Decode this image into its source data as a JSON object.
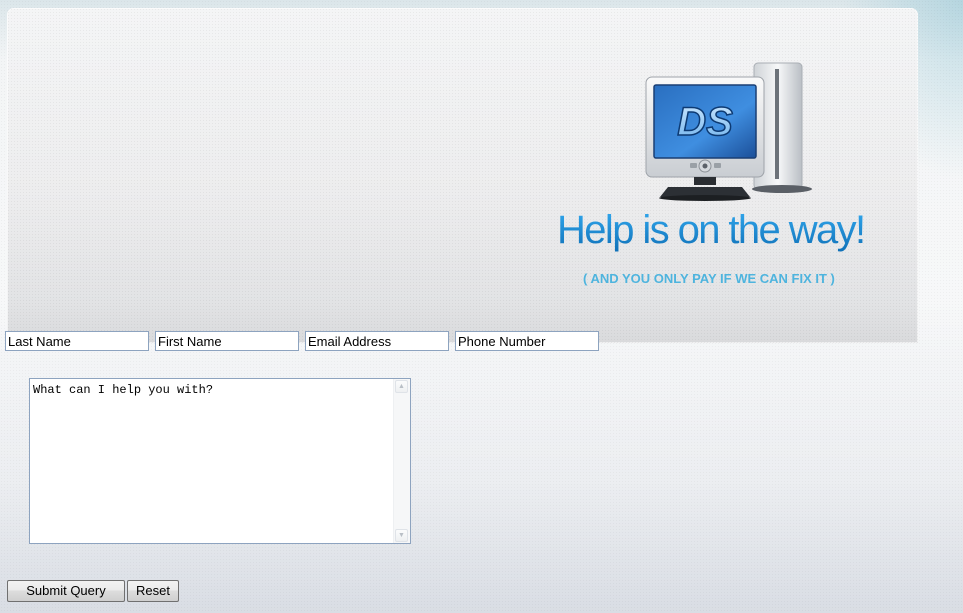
{
  "header": {
    "tagline": "Help is on the way!",
    "subtagline": "( AND YOU ONLY PAY IF WE CAN FIX IT )",
    "logo_text": "DS",
    "illustration_icon": "desktop-computer-icon",
    "colors": {
      "tagline": "#1a8fd3",
      "subtagline": "#4eb4de"
    }
  },
  "form": {
    "last_name": {
      "value": "Last Name"
    },
    "first_name": {
      "value": "First Name"
    },
    "email": {
      "value": "Email Address"
    },
    "phone": {
      "value": "Phone Number"
    },
    "message": {
      "value": "What can I help you with?"
    },
    "submit_label": "Submit Query",
    "reset_label": "Reset"
  }
}
